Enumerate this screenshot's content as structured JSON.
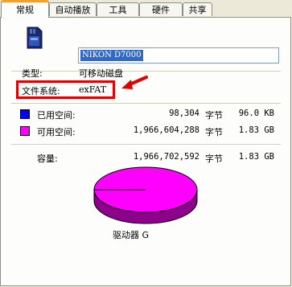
{
  "tabs": [
    {
      "label": "常规"
    },
    {
      "label": "自动播放"
    },
    {
      "label": "工具"
    },
    {
      "label": "硬件"
    },
    {
      "label": "共享"
    }
  ],
  "drive": {
    "name": "NIKON D7000",
    "type_label": "类型:",
    "type_value": "可移动磁盘",
    "fs_label": "文件系统:",
    "fs_value": "exFAT"
  },
  "usage": {
    "used_label": "已用空间:",
    "used_bytes": "98,304",
    "used_unit": "字节",
    "used_size": "96.0 KB",
    "used_color": "#0000ff",
    "free_label": "可用空间:",
    "free_bytes": "1,966,604,288",
    "free_unit": "字节",
    "free_size": "1.83 GB",
    "free_color": "#ff00ff",
    "capacity_label": "容量:",
    "capacity_bytes": "1,966,702,592",
    "capacity_unit": "字节",
    "capacity_size": "1.83 GB"
  },
  "chart_data": {
    "type": "pie",
    "labels": [
      "已用空间",
      "可用空间"
    ],
    "values": [
      98304,
      1966604288
    ],
    "colors": [
      "#0000ff",
      "#ff00ff"
    ]
  },
  "drive_label": "驱动器 G",
  "colors": {
    "tab_accent": "#f0a030",
    "annotation": "#e00000"
  },
  "icons": {
    "drive": "sd-card-icon",
    "annotation": "red-arrow"
  }
}
